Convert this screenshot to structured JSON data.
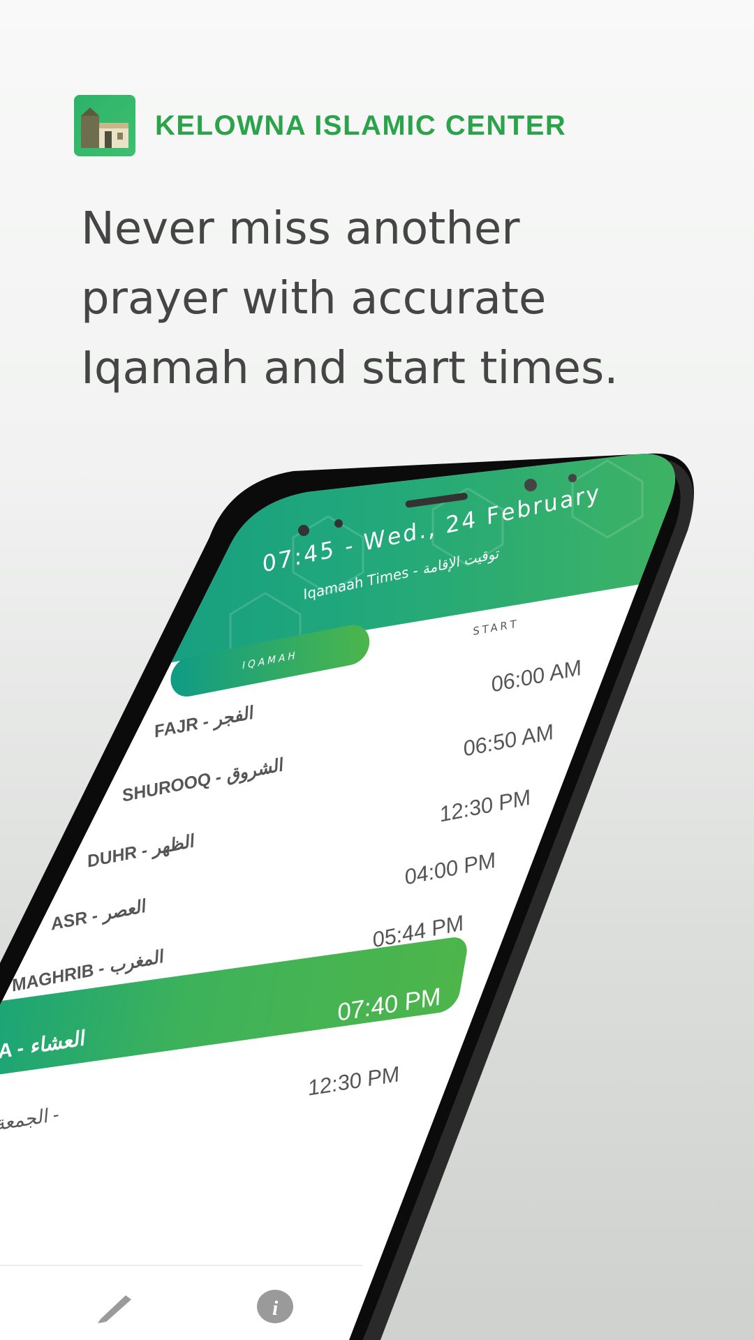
{
  "brand": {
    "name": "KELOWNA ISLAMIC CENTER",
    "logo_icon": "mosque-icon"
  },
  "headline": {
    "line1": "Never miss another",
    "line2": "prayer with accurate",
    "line3": "Iqamah and start times."
  },
  "app": {
    "header_main": "07:45 - Wed., 24 February",
    "header_sub": "Iqamaah Times -",
    "header_ar": "توقيت الإقامة",
    "tab_iqamah": "IQAMAH",
    "col_start": "START",
    "prayers": [
      {
        "name": "FAJR - الفجر",
        "time": "06:00 AM"
      },
      {
        "name": "SHUROOQ - الشروق",
        "time": "06:50 AM"
      },
      {
        "name": "DUHR - الظهر",
        "time": "12:30 PM"
      },
      {
        "name": "ASR - العصر",
        "time": "04:00 PM"
      },
      {
        "name": "MAGHRIB - المغرب",
        "time": "05:44 PM"
      },
      {
        "name": "A - العشاء",
        "time": "07:40 PM"
      },
      {
        "name": "الجمعة -",
        "time": "12:30 PM"
      }
    ],
    "nav": {
      "edit_icon": "pencil-icon",
      "info_icon": "info-icon"
    }
  },
  "colors": {
    "brand_green": "#2aa34a",
    "accent_start": "#139a7f",
    "accent_end": "#4db54a"
  }
}
